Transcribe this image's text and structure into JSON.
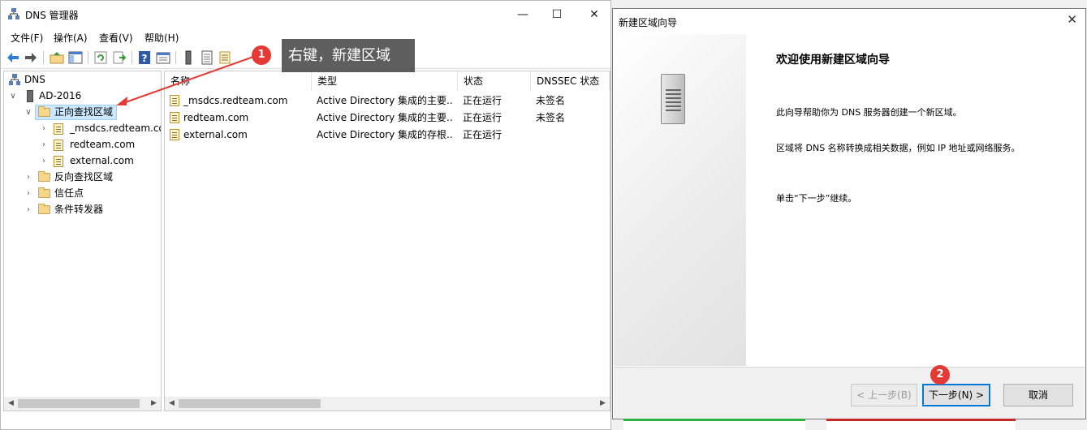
{
  "dns_window": {
    "title": "DNS 管理器",
    "menu": [
      "文件(F)",
      "操作(A)",
      "查看(V)",
      "帮助(H)"
    ],
    "tree": {
      "root": "DNS",
      "server": "AD-2016",
      "forward_zones": "正向查找区域",
      "zones": [
        "_msdcs.redteam.co",
        "redteam.com",
        "external.com"
      ],
      "reverse_zones": "反向查找区域",
      "trust_points": "信任点",
      "conditional_forwarders": "条件转发器"
    },
    "list": {
      "columns": [
        "名称",
        "类型",
        "状态",
        "DNSSEC 状态"
      ],
      "rows": [
        {
          "name": "_msdcs.redteam.com",
          "type": "Active Directory 集成的主要...",
          "status": "正在运行",
          "dnssec": "未签名"
        },
        {
          "name": "redteam.com",
          "type": "Active Directory 集成的主要...",
          "status": "正在运行",
          "dnssec": "未签名"
        },
        {
          "name": "external.com",
          "type": "Active Directory 集成的存根...",
          "status": "正在运行",
          "dnssec": ""
        }
      ]
    }
  },
  "callout": {
    "step1": "1",
    "text": "右键，新建区域",
    "step2": "2"
  },
  "wizard": {
    "title": "新建区域向导",
    "heading": "欢迎使用新建区域向导",
    "para1": "此向导帮助你为 DNS 服务器创建一个新区域。",
    "para2": "区域将 DNS 名称转换成相关数据，例如 IP 地址或网络服务。",
    "para3": "单击“下一步”继续。",
    "back": "< 上一步(B)",
    "next": "下一步(N) >",
    "cancel": "取消"
  },
  "colors": {
    "badge": "#e53935",
    "selection": "#cce8ff",
    "callout_bg": "#505050",
    "default_button_border": "#0078d7"
  }
}
